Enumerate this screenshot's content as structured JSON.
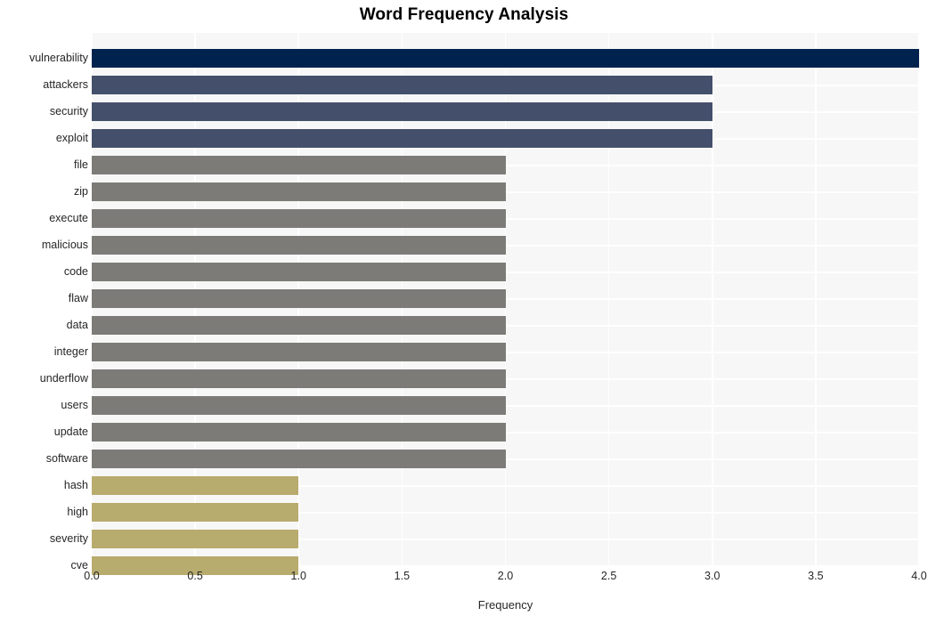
{
  "chart_data": {
    "type": "bar",
    "orientation": "horizontal",
    "title": "Word Frequency Analysis",
    "xlabel": "Frequency",
    "ylabel": "",
    "xlim": [
      0.0,
      4.0
    ],
    "xticks": [
      "0.0",
      "0.5",
      "1.0",
      "1.5",
      "2.0",
      "2.5",
      "3.0",
      "3.5",
      "4.0"
    ],
    "xtick_values": [
      0.0,
      0.5,
      1.0,
      1.5,
      2.0,
      2.5,
      3.0,
      3.5,
      4.0
    ],
    "grid": true,
    "grid_color": "#ffffff",
    "legend": "none",
    "plot_background": "#f7f7f7",
    "figure_background": "#ffffff",
    "categories": [
      "vulnerability",
      "attackers",
      "security",
      "exploit",
      "file",
      "zip",
      "execute",
      "malicious",
      "code",
      "flaw",
      "data",
      "integer",
      "underflow",
      "users",
      "update",
      "software",
      "hash",
      "high",
      "severity",
      "cve"
    ],
    "values": [
      4,
      3,
      3,
      3,
      2,
      2,
      2,
      2,
      2,
      2,
      2,
      2,
      2,
      2,
      2,
      2,
      1,
      1,
      1,
      1
    ],
    "bar_colors": [
      "#00224e",
      "#44506b",
      "#44506b",
      "#44506b",
      "#7c7b78",
      "#7c7b78",
      "#7c7b78",
      "#7c7b78",
      "#7c7b78",
      "#7c7b78",
      "#7c7b78",
      "#7c7b78",
      "#7c7b78",
      "#7c7b78",
      "#7c7b78",
      "#7c7b78",
      "#b8ab6e",
      "#b8ab6e",
      "#b8ab6e",
      "#b8ab6e"
    ],
    "palette_note": "cividis-like sequential palette keyed to frequency value"
  }
}
